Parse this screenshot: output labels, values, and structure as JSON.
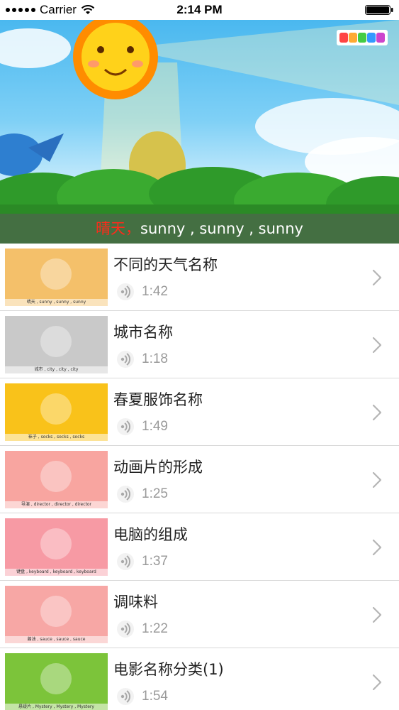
{
  "status_bar": {
    "carrier": "Carrier",
    "time": "2:14 PM",
    "icons": [
      "signal-dots-icon",
      "wifi-icon",
      "battery-icon"
    ]
  },
  "player": {
    "lyric_cn": "晴天，",
    "lyric_en": "sunny , sunny , sunny",
    "logo_icon": "liuyi-logo-icon"
  },
  "songs": [
    {
      "title": "不同的天气名称",
      "duration": "1:42",
      "caption": "晴天 , sunny , sunny , sunny",
      "thumb_bg": "#f4c06a"
    },
    {
      "title": "城市名称",
      "duration": "1:18",
      "caption": "城市 , city , city , city",
      "thumb_bg": "#c9c9c9"
    },
    {
      "title": "春夏服饰名称",
      "duration": "1:49",
      "caption": "袜子 , socks , socks , socks",
      "thumb_bg": "#f9c21a"
    },
    {
      "title": "动画片的形成",
      "duration": "1:25",
      "caption": "导演 , director , director , director",
      "thumb_bg": "#f8a5a0"
    },
    {
      "title": "电脑的组成",
      "duration": "1:37",
      "caption": "键盘 , keyboard , keyboard , keyboard",
      "thumb_bg": "#f79aa4"
    },
    {
      "title": "调味料",
      "duration": "1:22",
      "caption": "酱油 , sauce , sauce , sauce",
      "thumb_bg": "#f7a7a5"
    },
    {
      "title": "电影名称分类(1)",
      "duration": "1:54",
      "caption": "悬疑片 , Mystery , Mystery , Mystery",
      "thumb_bg": "#7cc43a"
    }
  ],
  "colors": {
    "lyric_highlight": "#ff2a1a",
    "duration_text": "#9a9a9a",
    "separator": "#d9d9d9"
  }
}
